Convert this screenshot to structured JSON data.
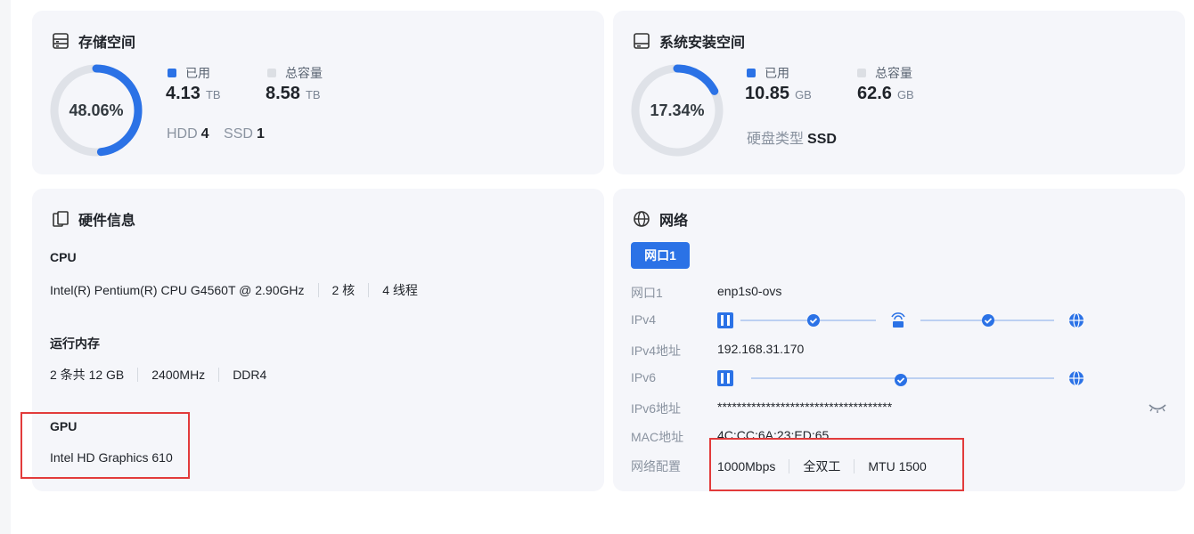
{
  "storage": {
    "title": "存储空间",
    "percent_label": "48.06%",
    "percent_value": 48.06,
    "used_label": "已用",
    "used_value": "4.13",
    "used_unit": "TB",
    "total_label": "总容量",
    "total_value": "8.58",
    "total_unit": "TB",
    "hdd_label": "HDD",
    "hdd_count": "4",
    "ssd_label": "SSD",
    "ssd_count": "1"
  },
  "system": {
    "title": "系统安装空间",
    "percent_label": "17.34%",
    "percent_value": 17.34,
    "used_label": "已用",
    "used_value": "10.85",
    "used_unit": "GB",
    "total_label": "总容量",
    "total_value": "62.6",
    "total_unit": "GB",
    "disk_type_label": "硬盘类型",
    "disk_type_value": "SSD"
  },
  "hardware": {
    "title": "硬件信息",
    "cpu_label": "CPU",
    "cpu_model": "Intel(R) Pentium(R) CPU G4560T @ 2.90GHz",
    "cpu_cores": "2 核",
    "cpu_threads": "4 线程",
    "ram_label": "运行内存",
    "ram_sticks": "2 条共 12 GB",
    "ram_freq": "2400MHz",
    "ram_type": "DDR4",
    "gpu_label": "GPU",
    "gpu_model": "Intel HD Graphics 610"
  },
  "network": {
    "title": "网络",
    "tab": "网口1",
    "rows": {
      "port_label": "网口1",
      "port_value": "enp1s0-ovs",
      "ipv4_label": "IPv4",
      "ipv4_addr_label": "IPv4地址",
      "ipv4_addr_value": "192.168.31.170",
      "ipv6_label": "IPv6",
      "ipv6_addr_label": "IPv6地址",
      "ipv6_addr_value": "************************************",
      "mac_label": "MAC地址",
      "mac_value": "4C:CC:6A:23:ED:65",
      "config_label": "网络配置",
      "speed": "1000Mbps",
      "duplex": "全双工",
      "mtu": "MTU 1500"
    }
  },
  "colors": {
    "accent": "#2b72e6",
    "ring_bg": "#dfe2e8",
    "legend_total": "#dcdfe4",
    "highlight": "#e23b3b"
  },
  "icons": [
    "storage-icon",
    "system-disk-icon",
    "hardware-icon",
    "globe-icon",
    "nas-icon",
    "router-icon",
    "check-icon",
    "eye-hidden-icon"
  ]
}
